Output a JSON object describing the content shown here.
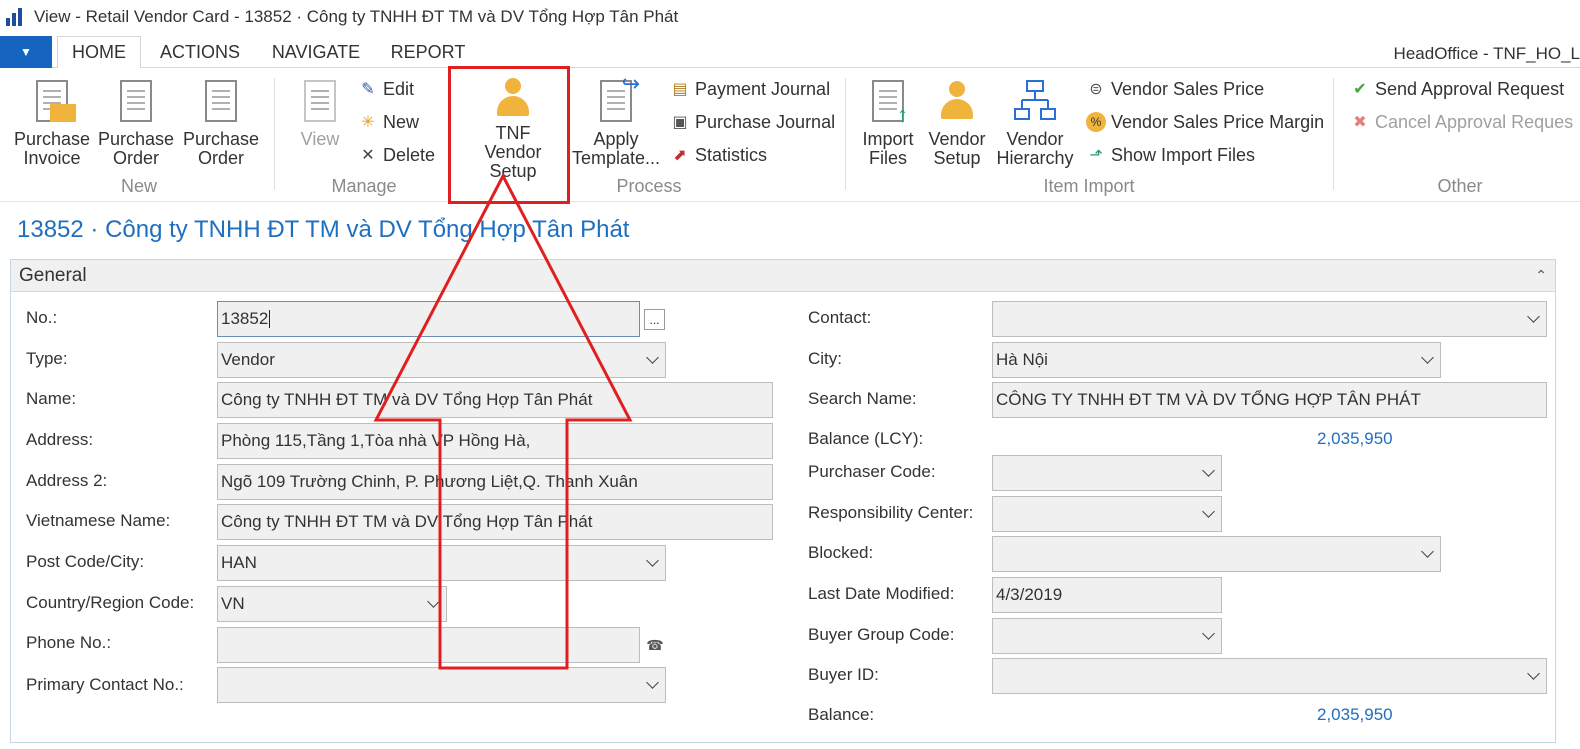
{
  "window": {
    "title": "View - Retail Vendor Card - 13852 · Công ty TNHH ĐT TM và DV Tổng Hợp Tân Phát",
    "company": "HeadOffice - TNF_HO_L"
  },
  "ribbon": {
    "tabs": [
      "HOME",
      "ACTIONS",
      "NAVIGATE",
      "REPORT"
    ],
    "active_tab": "HOME",
    "groups": {
      "new": {
        "label": "New",
        "buttons": [
          "Purchase Invoice",
          "Purchase Order",
          "Purchase Order"
        ]
      },
      "manage": {
        "label": "Manage",
        "view": "View",
        "edit": "Edit",
        "new": "New",
        "delete": "Delete"
      },
      "process": {
        "label": "Process",
        "tnf_vendor_setup": "TNF Vendor Setup",
        "apply_template": "Apply Template...",
        "payment_journal": "Payment Journal",
        "purchase_journal": "Purchase Journal",
        "statistics": "Statistics"
      },
      "item_import": {
        "label": "Item Import",
        "import_files": "Import Files",
        "vendor_setup": "Vendor Setup",
        "vendor_hierarchy": "Vendor Hierarchy",
        "vendor_sales_price": "Vendor Sales Price",
        "vendor_sales_price_margin": "Vendor Sales Price Margin",
        "show_import_files": "Show Import Files"
      },
      "other": {
        "label": "Other",
        "send_approval": "Send Approval Request",
        "cancel_approval": "Cancel Approval Reques"
      }
    }
  },
  "page": {
    "title": "13852 · Công ty TNHH ĐT TM và DV Tổng Hợp Tân Phát"
  },
  "general": {
    "header": "General",
    "left": {
      "no_label": "No.:",
      "no_value": "13852",
      "type_label": "Type:",
      "type_value": "Vendor",
      "name_label": "Name:",
      "name_value": "Công ty TNHH ĐT TM và DV Tổng Hợp Tân Phát",
      "address_label": "Address:",
      "address_value": "Phòng 115,Tầng 1,Tòa nhà VP Hồng Hà,",
      "address2_label": "Address 2:",
      "address2_value": "Ngõ 109 Trường Chinh, P. Phương Liệt,Q. Thanh Xuân",
      "vn_name_label": "Vietnamese Name:",
      "vn_name_value": "Công ty TNHH ĐT TM và DV Tổng Hợp Tân Phát",
      "post_code_label": "Post Code/City:",
      "post_code_value": "HAN",
      "country_label": "Country/Region Code:",
      "country_value": "VN",
      "phone_label": "Phone No.:",
      "phone_value": "",
      "primary_contact_label": "Primary Contact No.:",
      "primary_contact_value": ""
    },
    "right": {
      "contact_label": "Contact:",
      "contact_value": "",
      "city_label": "City:",
      "city_value": "Hà Nội",
      "search_name_label": "Search Name:",
      "search_name_value": "CÔNG TY TNHH ĐT TM VÀ DV TỔNG HỢP TÂN PHÁT",
      "balance_lcy_label": "Balance (LCY):",
      "balance_lcy_value": "2,035,950",
      "purchaser_label": "Purchaser Code:",
      "purchaser_value": "",
      "resp_center_label": "Responsibility Center:",
      "resp_center_value": "",
      "blocked_label": "Blocked:",
      "blocked_value": "",
      "last_modified_label": "Last Date Modified:",
      "last_modified_value": "4/3/2019",
      "buyer_group_label": "Buyer Group Code:",
      "buyer_group_value": "",
      "buyer_id_label": "Buyer ID:",
      "buyer_id_value": "",
      "balance_label": "Balance:",
      "balance_value": "2,035,950"
    }
  },
  "colors": {
    "accent": "#1565c0",
    "title_blue": "#1f6fbf",
    "annotation_red": "#e02020"
  }
}
